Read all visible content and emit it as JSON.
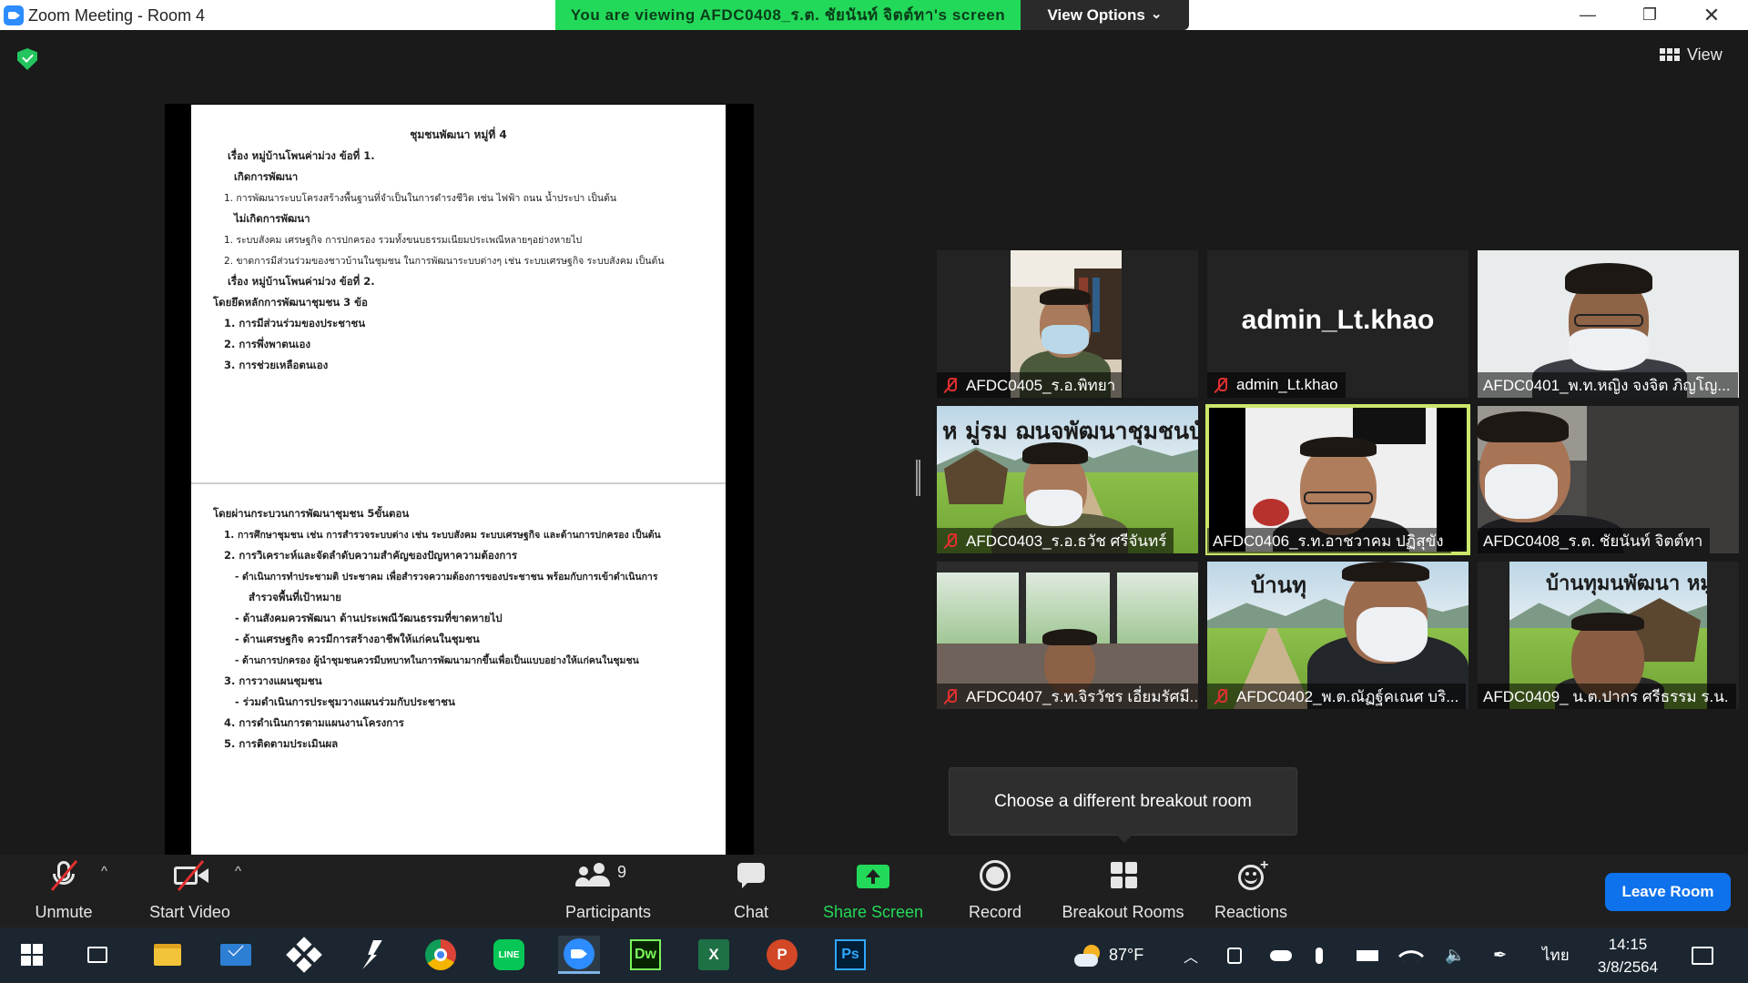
{
  "window": {
    "title": "Zoom Meeting - Room 4",
    "minimize": "—",
    "restore": "❐",
    "close": "✕"
  },
  "banner": {
    "viewing_text": "You are viewing AFDC0408_ร.ต. ชัยนันท์ จิตต์ทา's screen",
    "view_options_label": "View Options",
    "view_options_caret": "⌄"
  },
  "view_button": {
    "label": "View"
  },
  "document": {
    "title": "ชุมชนพัฒนา หมู่ที่ 4",
    "top_lines": [
      "เรื่อง หมู่บ้านโพนค่าม่วง ข้อที่ 1.",
      "เกิดการพัฒนา",
      "1. การพัฒนาระบบโครงสร้างพื้นฐานที่จำเป็นในการดำรงชีวิต เช่น ไฟฟ้า ถนน น้ำประปา เป็นต้น",
      "ไม่เกิดการพัฒนา",
      "1. ระบบสังคม เศรษฐกิจ การปกครอง รวมทั้งขนบธรรมเนียมประเพณีหลายๆอย่างหายไป",
      "2. ขาดการมีส่วนร่วมของชาวบ้านในชุมชน ในการพัฒนาระบบต่างๆ เช่น ระบบเศรษฐกิจ ระบบสังคม เป็นต้น",
      "เรื่อง หมู่บ้านโพนค่าม่วง ข้อที่ 2.",
      "โดยยึดหลักการพัฒนาชุมชน 3 ข้อ",
      "1. การมีส่วนร่วมของประชาชน",
      "2. การพึ่งพาตนเอง",
      "3. การช่วยเหลือตนเอง"
    ],
    "bottom_lines": [
      "โดยผ่านกระบวนการพัฒนาชุมชน 5ขั้นตอน",
      "1. การศึกษาชุมชน เช่น การสำรวจระบบต่าง เช่น ระบบสังคม ระบบเศรษฐกิจ และด้านการปกครอง เป็นต้น",
      "2. การวิเคราะห์และจัดลำดับความสำคัญของปัญหาความต้องการ",
      "- ดำเนินการทำประชามติ ประชาคม เพื่อสำรวจความต้องการของประชาชน พร้อมกับการเข้าดำเนินการ",
      "สำรวจพื้นที่เป้าหมาย",
      "- ด้านสังคมควรพัฒนา ด้านประเพณีวัฒนธรรมที่ขาดหายไป",
      "- ด้านเศรษฐกิจ ควรมีการสร้างอาชีพให้แก่คนในชุมชน",
      "- ด้านการปกครอง ผู้นำชุมชนควรมีบทบาทในการพัฒนามากขึ้นเพื่อเป็นแบบอย่างให้แก่คนในชุมชน",
      "3. การวางแผนชุมชน",
      "- ร่วมดำเนินการประชุมวางแผนร่วมกับประชาชน",
      "4. การดำเนินการตามแผนงานโครงการ",
      "5. การติดตามประเมินผล"
    ]
  },
  "participants": [
    {
      "name": "AFDC0405_ร.อ.พิทยา",
      "muted": true
    },
    {
      "name": "admin_Lt.khao",
      "muted": true,
      "display_name": "admin_Lt.khao"
    },
    {
      "name": "AFDC0401_พ.ท.หญิง จงจิต ภิญโญ...",
      "muted": false
    },
    {
      "name": "AFDC0403_ร.อ.ธวัช ศรีจันทร์",
      "muted": true,
      "overlay": "ห มู่รม ฌนจพัฒนาชุมชนบั"
    },
    {
      "name": "AFDC0406_ร.ท.อาชวาคม ปฏิสุขัง",
      "muted": false,
      "active": true
    },
    {
      "name": "AFDC0408_ร.ต. ชัยนันท์ จิตต์ทา",
      "muted": false
    },
    {
      "name": "AFDC0407_ร.ท.จิรวัชร เอี่ยมรัศมี...",
      "muted": true
    },
    {
      "name": "AFDC0402_พ.ต.ณัฏฐ์คเณศ บริ...",
      "muted": true,
      "overlay": "บ้านทุ"
    },
    {
      "name": "AFDC0409_ น.ต.ปากร ศรีธรรม ร.น.",
      "muted": false,
      "overlay": "บ้านทุมนพัฒนา หมู่"
    }
  ],
  "tooltip": {
    "breakout": "Choose a different breakout room"
  },
  "toolbar": {
    "unmute": "Unmute",
    "start_video": "Start Video",
    "participants": "Participants",
    "participants_count": "9",
    "chat": "Chat",
    "share_screen": "Share Screen",
    "record": "Record",
    "breakout_rooms": "Breakout Rooms",
    "reactions": "Reactions",
    "leave": "Leave Room",
    "caret": "^"
  },
  "taskbar": {
    "temperature": "87°F",
    "language": "ไทย",
    "time": "14:15",
    "date": "3/8/2564"
  },
  "colors": {
    "banner_green": "#23d959",
    "share_green": "#23d959",
    "leave_blue": "#0e72ed",
    "active_speaker": "#cbe86b",
    "muted_red": "#e03030"
  }
}
